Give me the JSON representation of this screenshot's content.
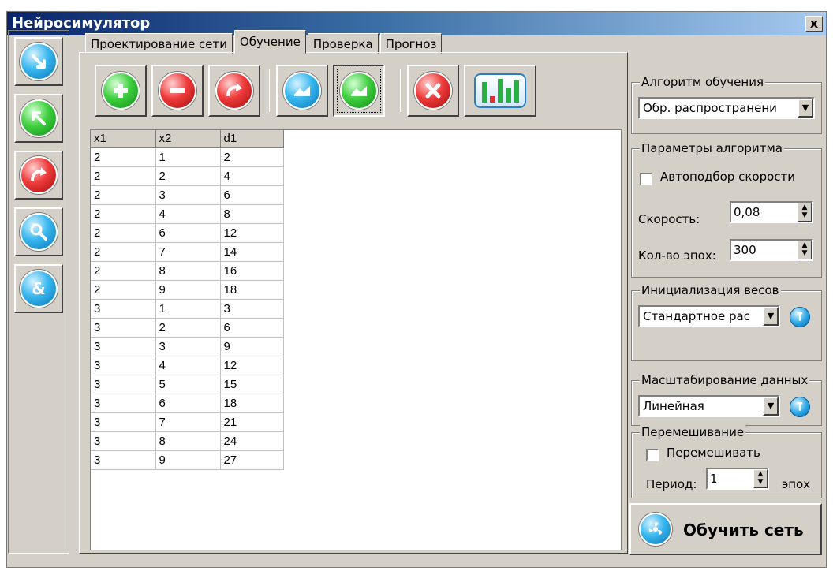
{
  "window": {
    "title": "Нейросимулятор",
    "close_glyph": "x"
  },
  "sidebar": {
    "buttons": [
      {
        "icon": "design-icon"
      },
      {
        "icon": "train-arrow-icon"
      },
      {
        "icon": "redo-icon"
      },
      {
        "icon": "magnifier-icon"
      },
      {
        "icon": "ampersand-icon"
      }
    ]
  },
  "tabs": [
    {
      "label": "Проектирование сети",
      "active": false
    },
    {
      "label": "Обучение",
      "active": true
    },
    {
      "label": "Проверка",
      "active": false
    },
    {
      "label": "Прогноз",
      "active": false
    }
  ],
  "toolbar": {
    "buttons": [
      "add-icon",
      "remove-icon",
      "redo-icon",
      "import-icon",
      "export-icon",
      "delete-icon",
      "histogram-icon"
    ]
  },
  "table": {
    "columns": [
      "x1",
      "x2",
      "d1"
    ],
    "rows": [
      [
        "2",
        "1",
        "2"
      ],
      [
        "2",
        "2",
        "4"
      ],
      [
        "2",
        "3",
        "6"
      ],
      [
        "2",
        "4",
        "8"
      ],
      [
        "2",
        "6",
        "12"
      ],
      [
        "2",
        "7",
        "14"
      ],
      [
        "2",
        "8",
        "16"
      ],
      [
        "2",
        "9",
        "18"
      ],
      [
        "3",
        "1",
        "3"
      ],
      [
        "3",
        "2",
        "6"
      ],
      [
        "3",
        "3",
        "9"
      ],
      [
        "3",
        "4",
        "12"
      ],
      [
        "3",
        "5",
        "15"
      ],
      [
        "3",
        "6",
        "18"
      ],
      [
        "3",
        "7",
        "21"
      ],
      [
        "3",
        "8",
        "24"
      ],
      [
        "3",
        "9",
        "27"
      ]
    ]
  },
  "panel": {
    "algorithm": {
      "title": "Алгоритм обучения",
      "value": "Обр. распространени"
    },
    "params": {
      "title": "Параметры алгоритма",
      "auto_label": "Автоподбор скорости",
      "speed_label": "Скорость:",
      "speed_value": "0,08",
      "epochs_label": "Кол-во эпох:",
      "epochs_value": "300"
    },
    "init": {
      "title": "Инициализация весов",
      "value": "Стандартное рас"
    },
    "scaling": {
      "title": "Масштабирование данных",
      "value": "Линейная"
    },
    "shuffle": {
      "title": "Перемешивание",
      "check_label": "Перемешивать",
      "period_label": "Период:",
      "period_value": "1",
      "unit": "эпох"
    },
    "train_button": "Обучить сеть"
  },
  "colors": {
    "face": "#d4d0c8",
    "title_start": "#0a246a",
    "title_end": "#a6caf0"
  }
}
